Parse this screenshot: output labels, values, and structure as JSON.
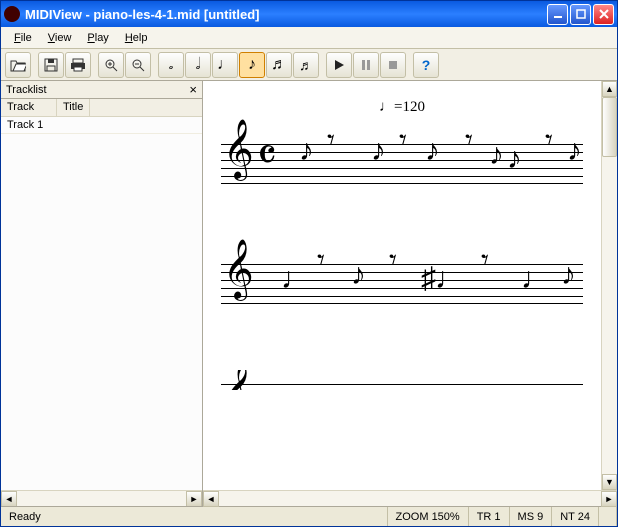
{
  "window": {
    "title": "MIDIView - piano-les-4-1.mid [untitled]"
  },
  "menu": {
    "file": "File",
    "view": "View",
    "play": "Play",
    "help": "Help"
  },
  "sidebar": {
    "title": "Tracklist",
    "headers": {
      "track": "Track",
      "title": "Title"
    },
    "rows": [
      {
        "track": "Track 1",
        "title": ""
      }
    ]
  },
  "sheet": {
    "tempo": "♩=120"
  },
  "status": {
    "ready": "Ready",
    "zoom": "ZOOM 150%",
    "tr": "TR 1",
    "ms": "MS 9",
    "nt": "NT 24"
  },
  "icons": {
    "open": "open-icon",
    "save": "save-icon",
    "print": "print-icon",
    "zoomin": "zoom-in-icon",
    "zoomout": "zoom-out-icon",
    "whole": "whole-note-icon",
    "half": "half-note-icon",
    "quarter": "quarter-note-icon",
    "eighth": "eighth-note-icon",
    "sixteenth": "sixteenth-note-icon",
    "thirtysecond": "thirtysecond-note-icon",
    "play": "play-icon",
    "pause": "pause-icon",
    "stop": "stop-icon",
    "help": "help-icon"
  }
}
